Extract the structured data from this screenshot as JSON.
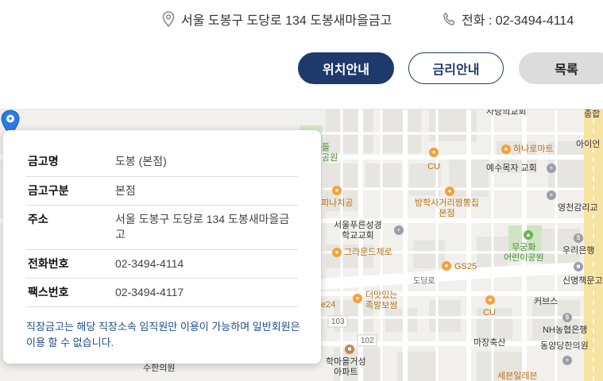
{
  "header": {
    "address": "서울 도봉구 도당로 134 도봉새마을금고",
    "phone": "전화 : 02-3494-4114",
    "address_icon": "location-pin-icon",
    "phone_icon": "phone-icon",
    "buttons": {
      "location": "위치안내",
      "rates": "금리안내",
      "list": "목록"
    }
  },
  "colors": {
    "primary": "#1e3a6b",
    "notice": "#1f4f86",
    "pin": "#2a7be4",
    "map_bg": "#f1f0ec"
  },
  "info": {
    "rows": [
      {
        "label": "금고명",
        "value": "도봉 (본점)"
      },
      {
        "label": "금고구분",
        "value": "본점"
      },
      {
        "label": "주소",
        "value": "서울 도봉구 도당로 134 도봉새마을금고"
      },
      {
        "label": "전화번호",
        "value": "02-3494-4114"
      },
      {
        "label": "팩스번호",
        "value": "02-3494-4117"
      }
    ],
    "notice": "직장금고는 해당 직장소속 임직원만 이용이 가능하며 일반회원은 이용 할 수 없습니다."
  },
  "map": {
    "labels": {
      "church_top": "사랑의교회",
      "church_top_right": "종합",
      "hanaro": "하나로마트",
      "aiin": "아이언",
      "yesu": "예수목자 교회",
      "cu1": "CU",
      "park_top": "들\n공원",
      "pinachi": "피나치공",
      "bangha": "방학사거리짬뽕집\n본점",
      "youngchun": "영천감리교",
      "seoul_church": "서울푸른성경\n학교교회",
      "granud": "그라운드제로",
      "mugunghwa": "무궁화\n어린이공원",
      "woori": "우리은행",
      "sinmyung": "신명책문고",
      "gs25": "GS25",
      "dodangro": "도당로",
      "deomat": "더맛있는\n족발보쌈",
      "e24": "e24",
      "cu2": "CU",
      "kobus": "커브스",
      "nh": "NH농협은행",
      "dongyang": "동양당한의원",
      "r103": "103",
      "r102": "102",
      "masang": "마장축산",
      "hakmaeul": "학마을거성\n아파트",
      "suhan": "수한의원",
      "sebit": "세븐일레븐"
    }
  }
}
